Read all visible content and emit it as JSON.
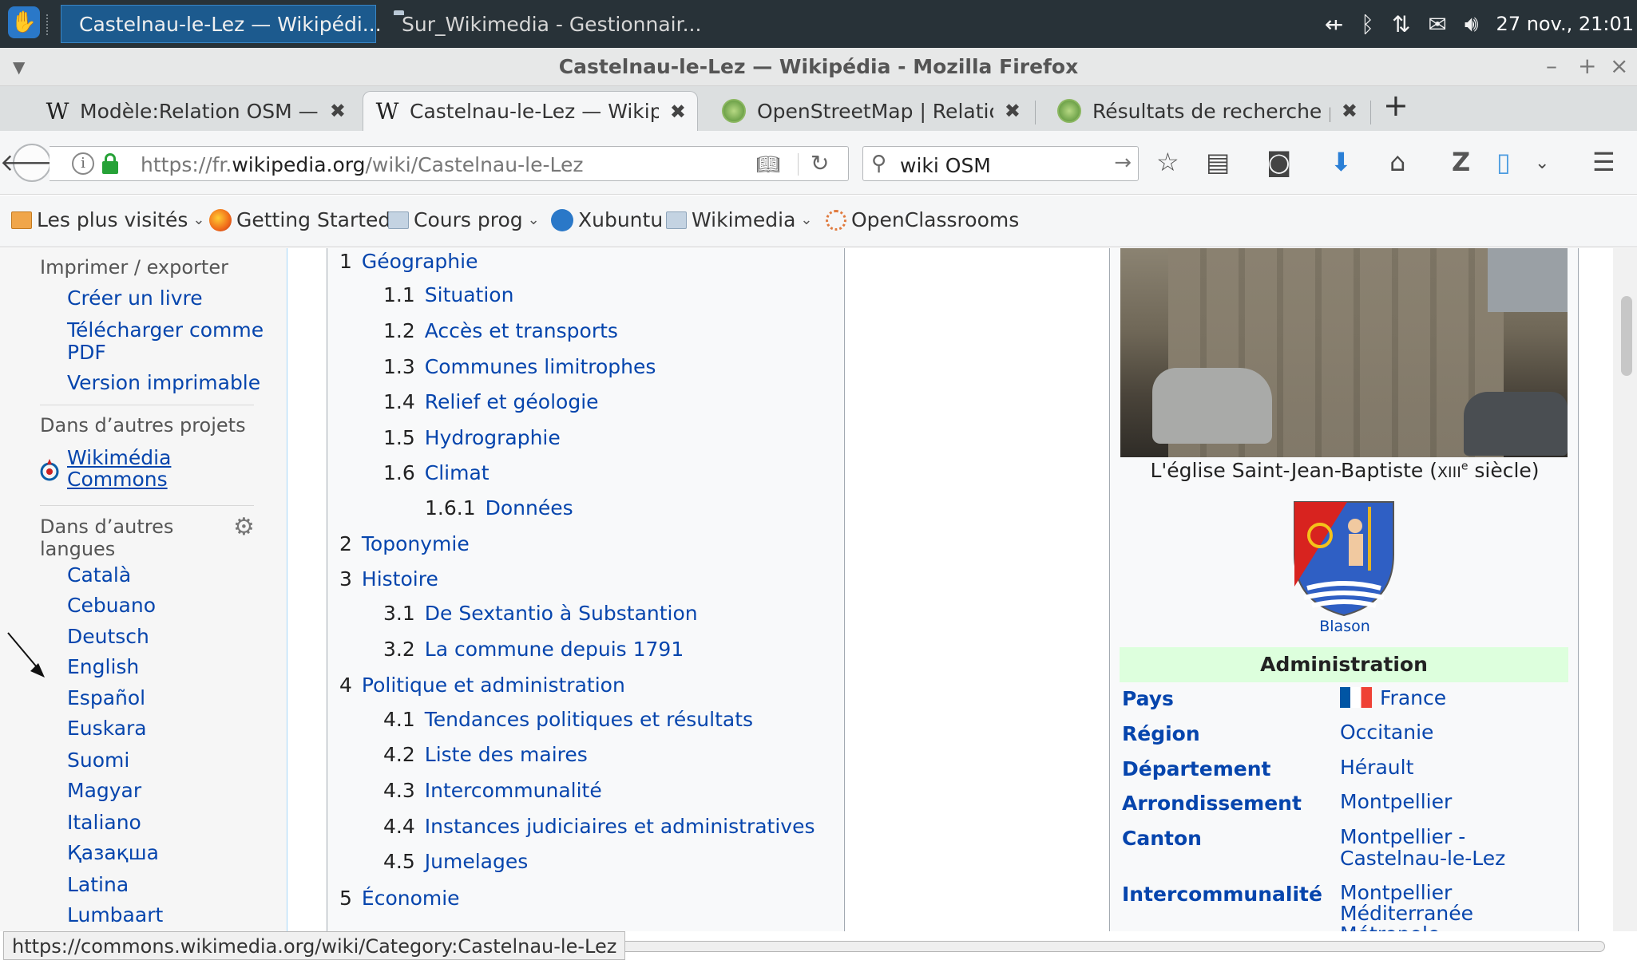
{
  "taskbar": {
    "tasks": [
      {
        "label": "Castelnau-le-Lez — Wikipédi..."
      },
      {
        "label": "Sur_Wikimedia - Gestionnair..."
      }
    ],
    "clock": "27 nov., 21:01"
  },
  "window": {
    "title": "Castelnau-le-Lez — Wikipédia - Mozilla Firefox"
  },
  "tabs": [
    {
      "label": "Modèle:Relation OSM — ..."
    },
    {
      "label": "Castelnau-le-Lez — Wikip..."
    },
    {
      "label": "OpenStreetMap | Relatio..."
    },
    {
      "label": "Résultats de recherche p..."
    }
  ],
  "urlbar": {
    "prefix": "https://fr.",
    "domain": "wikipedia.org",
    "path": "/wiki/Castelnau-le-Lez"
  },
  "searchbar": {
    "query": "wiki OSM"
  },
  "bookmarks": [
    {
      "label": "Les plus visités"
    },
    {
      "label": "Getting Started"
    },
    {
      "label": "Cours prog"
    },
    {
      "label": "Xubuntu"
    },
    {
      "label": "Wikimedia"
    },
    {
      "label": "OpenClassrooms"
    }
  ],
  "sidebar": {
    "print_heading": "Imprimer / exporter",
    "print_links": [
      "Créer un livre",
      "Télécharger comme",
      "PDF",
      "Version imprimable"
    ],
    "projects_heading": "Dans d’autres projets",
    "commons_link": [
      "Wikimédia",
      "Commons"
    ],
    "languages_heading": [
      "Dans d’autres",
      "langues"
    ],
    "languages": [
      "Català",
      "Cebuano",
      "Deutsch",
      "English",
      "Español",
      "Euskara",
      "Suomi",
      "Magyar",
      "Italiano",
      "Қазақша",
      "Latina",
      "Lumbaart"
    ]
  },
  "toc": [
    {
      "num": "1",
      "label": "Géographie"
    },
    {
      "num": "1.1",
      "label": "Situation"
    },
    {
      "num": "1.2",
      "label": "Accès et transports"
    },
    {
      "num": "1.3",
      "label": "Communes limitrophes"
    },
    {
      "num": "1.4",
      "label": "Relief et géologie"
    },
    {
      "num": "1.5",
      "label": "Hydrographie"
    },
    {
      "num": "1.6",
      "label": "Climat"
    },
    {
      "num": "1.6.1",
      "label": "Données"
    },
    {
      "num": "2",
      "label": "Toponymie"
    },
    {
      "num": "3",
      "label": "Histoire"
    },
    {
      "num": "3.1",
      "label": "De Sextantio à Substantion"
    },
    {
      "num": "3.2",
      "label": "La commune depuis 1791"
    },
    {
      "num": "4",
      "label": "Politique et administration"
    },
    {
      "num": "4.1",
      "label": "Tendances politiques et résultats"
    },
    {
      "num": "4.2",
      "label": "Liste des maires"
    },
    {
      "num": "4.3",
      "label": "Intercommunalité"
    },
    {
      "num": "4.4",
      "label": "Instances judiciaires et administratives"
    },
    {
      "num": "4.5",
      "label": "Jumelages"
    },
    {
      "num": "5",
      "label": "Économie"
    }
  ],
  "infobox": {
    "caption_pre": "L'église Saint-Jean-Baptiste (",
    "caption_century": "XIII",
    "caption_sup": "e",
    "caption_post": " siècle)",
    "blason_label": "Blason",
    "admin_header": "Administration",
    "rows": [
      {
        "label": "Pays",
        "value": [
          "France"
        ]
      },
      {
        "label": "Région",
        "value": [
          "Occitanie"
        ]
      },
      {
        "label": "Département",
        "value": [
          "Hérault"
        ]
      },
      {
        "label": "Arrondissement",
        "value": [
          "Montpellier"
        ]
      },
      {
        "label": "Canton",
        "value": [
          "Montpellier -",
          "Castelnau-le-Lez"
        ]
      },
      {
        "label": "Intercommunalité",
        "value": [
          "Montpellier",
          "Méditerranée",
          "Métropole"
        ]
      }
    ]
  },
  "status": {
    "url": "https://commons.wikimedia.org/wiki/Category:Castelnau-le-Lez"
  },
  "icons": [
    "xfce-menu-icon",
    "firefox-icon",
    "folder-icon",
    "bluetooth-icon",
    "network-icon",
    "mail-icon",
    "volume-icon",
    "wikipedia-w-icon",
    "osm-icon",
    "back-arrow-icon",
    "info-icon",
    "lock-icon",
    "reader-view-icon",
    "reload-icon",
    "search-icon",
    "bookmark-star-icon",
    "library-icon",
    "pocket-icon",
    "download-icon",
    "home-icon",
    "zotero-icon",
    "page-icon",
    "hamburger-menu-icon",
    "gear-icon",
    "wikimedia-commons-icon",
    "mouse-cursor-icon"
  ]
}
